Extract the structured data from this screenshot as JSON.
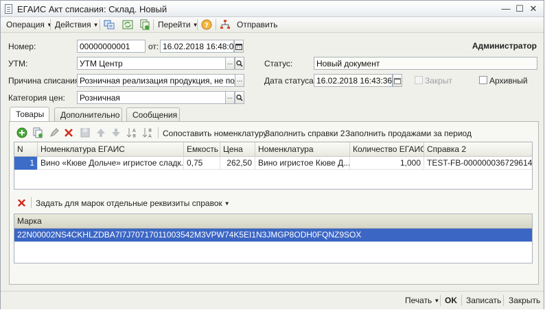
{
  "window": {
    "title": "ЕГАИС Акт списания: Склад. Новый"
  },
  "toolbar": {
    "operation": "Операция",
    "actions": "Действия",
    "goto": "Перейти",
    "help": "?",
    "send": "Отправить"
  },
  "form": {
    "number_label": "Номер:",
    "number_value": "00000000001",
    "from_label": "от:",
    "from_value": "16.02.2018 16:48:08",
    "user": "Администратор",
    "utm_label": "УТМ:",
    "utm_value": "УТМ Центр",
    "status_label": "Статус:",
    "status_value": "Новый документ",
    "reason_label": "Причина списания:",
    "reason_value": "Розничная реализация продукция, не подле:",
    "status_date_label": "Дата статуса:",
    "status_date_value": "16.02.2018 16:43:36",
    "closed_label": "Закрыт",
    "archive_label": "Архивный",
    "price_cat_label": "Категория цен:",
    "price_cat_value": "Розничная"
  },
  "tabs": [
    "Товары",
    "Дополнительно",
    "Сообщения"
  ],
  "goods_toolbar": {
    "match": "Сопоставить номенклатуру",
    "fill_refs": "Заполнить справки 2",
    "fill_sales": "Заполнить продажами за период"
  },
  "goods_table": {
    "columns": [
      "N",
      "Номенклатура ЕГАИС",
      "Емкость",
      "Цена",
      "Номенклатура",
      "Количество ЕГАИС",
      "Справка 2"
    ],
    "rows": [
      [
        "1",
        "Вино «Кюве Дольче» игристое сладк...",
        "0,75",
        "262,50",
        "Вино игристое Кюве Д...",
        "1,000",
        "TEST-FB-000000036729614"
      ]
    ]
  },
  "marks_toolbar": {
    "set_props": "Задать для марок отдельные реквизиты справок"
  },
  "marks_table": {
    "header": "Марка",
    "rows": [
      "22N00002NS4CKHLZDBA7I7J70717011003542M3VPW74K5EI1N3JMGP8ODH0FQNZ9SOX"
    ]
  },
  "footer": {
    "print": "Печать",
    "ok": "OK",
    "save": "Записать",
    "close": "Закрыть"
  }
}
